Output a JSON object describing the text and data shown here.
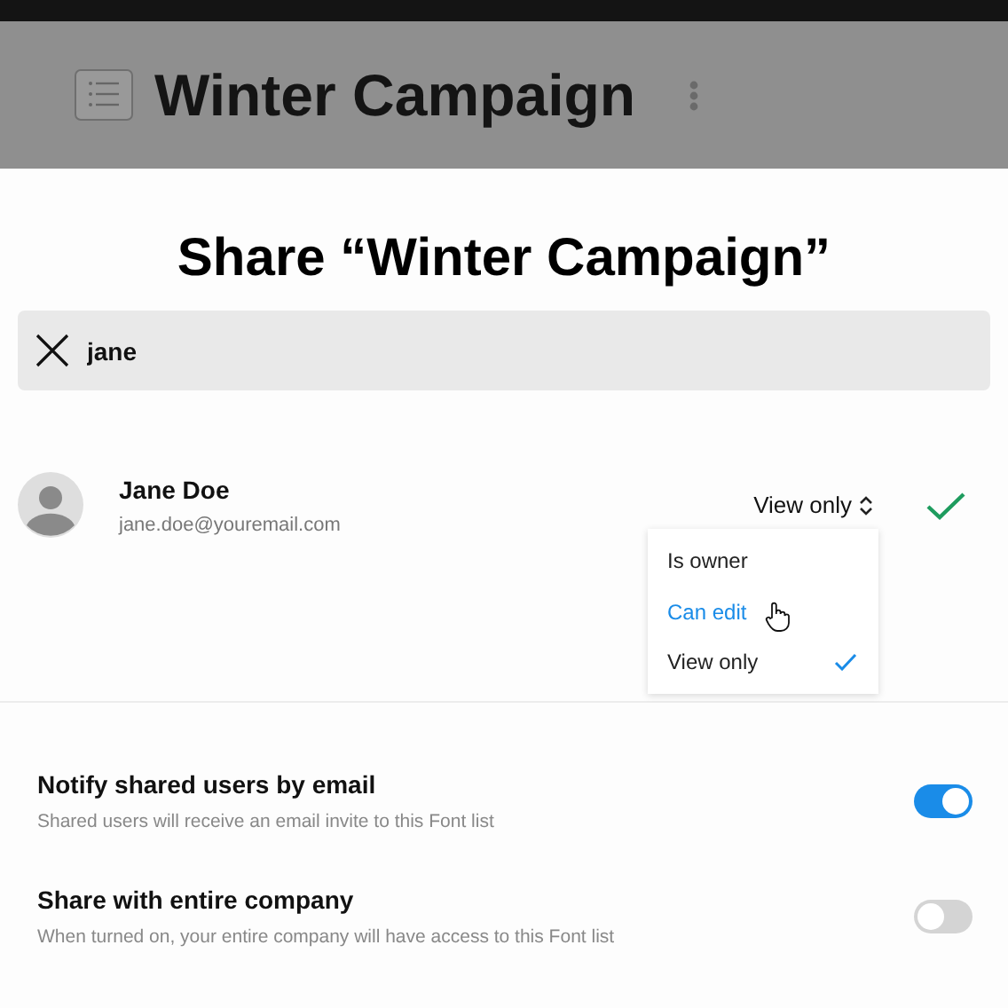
{
  "header": {
    "title": "Winter Campaign"
  },
  "dialog": {
    "title": "Share “Winter Campaign”"
  },
  "search": {
    "value": "jane"
  },
  "user": {
    "name": "Jane Doe",
    "email": "jane.doe@youremail.com",
    "role": "View only",
    "added": true
  },
  "role_menu": [
    {
      "label": "Is owner",
      "selected": false,
      "hovered": false
    },
    {
      "label": "Can edit",
      "selected": false,
      "hovered": true
    },
    {
      "label": "View only",
      "selected": true,
      "hovered": false
    }
  ],
  "settings": [
    {
      "title": "Notify shared users by email",
      "description": "Shared users will receive an email invite to this Font list",
      "on": true
    },
    {
      "title": "Share with entire company",
      "description": "When turned on, your entire company will have access to this Font list",
      "on": false
    }
  ]
}
